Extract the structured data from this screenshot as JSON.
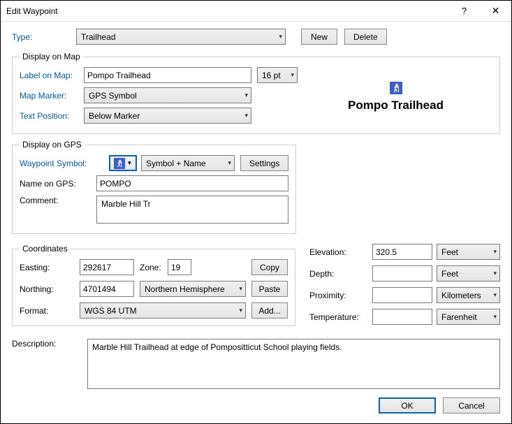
{
  "window": {
    "title": "Edit Waypoint"
  },
  "type": {
    "label": "Type:",
    "value": "Trailhead",
    "new_btn": "New",
    "delete_btn": "Delete"
  },
  "display_map": {
    "legend": "Display on Map",
    "label_on_map": "Label on Map:",
    "label_value": "Pompo Trailhead",
    "font_size": "16 pt",
    "map_marker": "Map Marker:",
    "marker_value": "GPS Symbol",
    "text_position": "Text Position:",
    "position_value": "Below Marker",
    "preview_text": "Pompo Trailhead"
  },
  "display_gps": {
    "legend": "Display on GPS",
    "waypoint_symbol": "Waypoint Symbol:",
    "symbol_mode": "Symbol + Name",
    "settings_btn": "Settings",
    "name_on_gps": "Name on GPS:",
    "name_value": "POMPO",
    "comment": "Comment:",
    "comment_value": "Marble Hill Tr"
  },
  "coords": {
    "legend": "Coordinates",
    "easting": "Easting:",
    "easting_value": "292617",
    "zone": "Zone:",
    "zone_value": "19",
    "northing": "Northing:",
    "northing_value": "4701494",
    "hemisphere": "Northern Hemisphere",
    "format": "Format:",
    "format_value": "WGS 84 UTM",
    "copy_btn": "Copy",
    "paste_btn": "Paste",
    "add_btn": "Add..."
  },
  "measures": {
    "elevation": "Elevation:",
    "elevation_value": "320.5",
    "elevation_unit": "Feet",
    "depth": "Depth:",
    "depth_value": "",
    "depth_unit": "Feet",
    "proximity": "Proximity:",
    "proximity_value": "",
    "proximity_unit": "Kilometers",
    "temperature": "Temperature:",
    "temperature_value": "",
    "temperature_unit": "Farenheit"
  },
  "description": {
    "label": "Description:",
    "value": "Marble Hill Trailhead at edge of Pompositticut School playing fields."
  },
  "footer": {
    "ok": "OK",
    "cancel": "Cancel"
  }
}
